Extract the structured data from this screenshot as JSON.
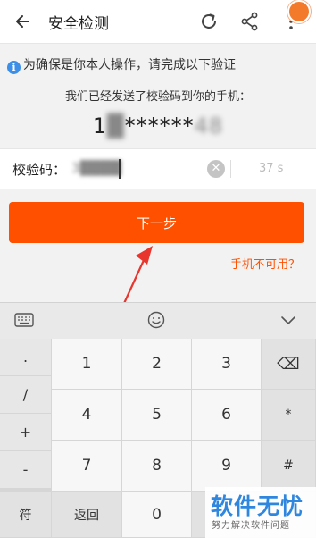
{
  "header": {
    "title": "安全检测"
  },
  "verify": {
    "notice": "为确保是你本人操作，请完成以下验证",
    "sent_text": "我们已经发送了校验码到你的手机：",
    "phone_prefix": "1",
    "phone_hidden_start": "█",
    "phone_masked": "******",
    "phone_hidden_end": "48",
    "code_label": "校验码：",
    "code_value": "3████",
    "countdown": "37 s"
  },
  "actions": {
    "next_label": "下一步",
    "phone_unavailable": "手机不可用？"
  },
  "keyboard": {
    "symbols": [
      ".",
      "/",
      "+",
      "-"
    ],
    "rows": [
      [
        "1",
        "2",
        "3"
      ],
      [
        "4",
        "5",
        "6"
      ],
      [
        "7",
        "8",
        "9"
      ]
    ],
    "right_col": [
      "⌫",
      "*",
      "#"
    ],
    "bottom": {
      "symbol_key": "符",
      "back_key": "返回",
      "zero_key": "0"
    }
  },
  "watermark": {
    "main": "软件无忧",
    "sub": "努力解决软件问题"
  },
  "colors": {
    "accent": "#ff5000",
    "info": "#3d8ee6",
    "watermark": "#2f86de"
  }
}
